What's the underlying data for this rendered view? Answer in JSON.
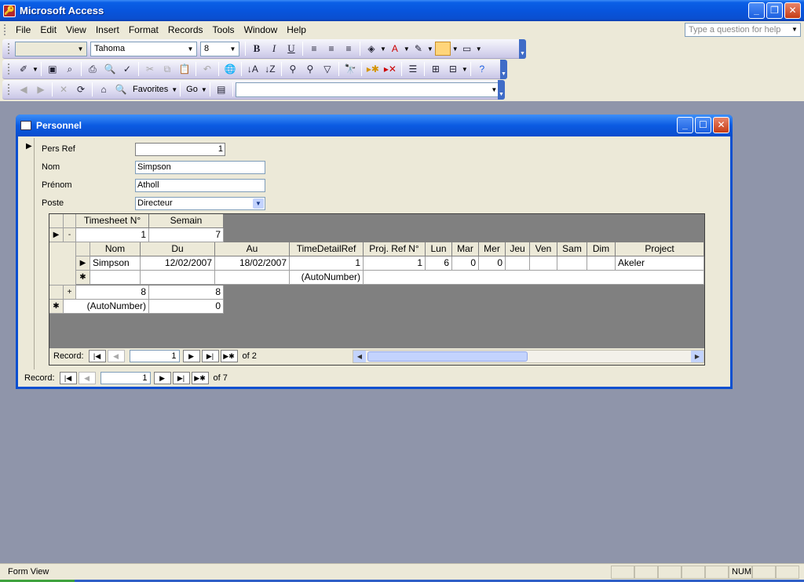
{
  "app": {
    "title": "Microsoft Access",
    "icon": "access-key-icon"
  },
  "window_controls": {
    "minimize": "_",
    "restore": "❐",
    "close": "✕"
  },
  "menu": [
    "File",
    "Edit",
    "View",
    "Insert",
    "Format",
    "Records",
    "Tools",
    "Window",
    "Help"
  ],
  "help_box": {
    "placeholder": "Type a question for help"
  },
  "format_toolbar": {
    "object_combo": "",
    "font": "Tahoma",
    "size": "8"
  },
  "web_toolbar": {
    "favorites": "Favorites",
    "go": "Go",
    "address": ""
  },
  "form": {
    "title": "Personnel",
    "fields": [
      {
        "label": "Pers Ref",
        "value": "1"
      },
      {
        "label": "Nom",
        "value": "Simpson"
      },
      {
        "label": "Prénom",
        "value": "Atholl"
      },
      {
        "label": "Poste",
        "value": "Directeur"
      }
    ],
    "subform": {
      "headers": [
        "Timesheet N°",
        "Semain"
      ],
      "rows": [
        {
          "expander": "-",
          "timesheet": "1",
          "semain": "7"
        },
        {
          "expander": "+",
          "timesheet": "8",
          "semain": "8"
        },
        {
          "expander": "✱",
          "timesheet": "(AutoNumber)",
          "semain": "0"
        }
      ],
      "detail": {
        "headers": [
          "Nom",
          "Du",
          "Au",
          "TimeDetailRef",
          "Proj. Ref N°",
          "Lun",
          "Mar",
          "Mer",
          "Jeu",
          "Ven",
          "Sam",
          "Dim",
          "Project"
        ],
        "row": {
          "nom": "Simpson",
          "du": "12/02/2007",
          "au": "18/02/2007",
          "timedetailref": "1",
          "projref": "1",
          "lun": "6",
          "mar": "0",
          "mer": "0",
          "jeu": "",
          "ven": "",
          "sam": "",
          "dim": "",
          "project": "Akeler"
        },
        "new_row": {
          "timedetailref": "(AutoNumber)"
        }
      },
      "nav": {
        "label": "Record:",
        "current": "1",
        "of": "of 2"
      }
    },
    "nav": {
      "label": "Record:",
      "current": "1",
      "of": "of 7"
    }
  },
  "status": {
    "text": "Form View",
    "num": "NUM"
  }
}
